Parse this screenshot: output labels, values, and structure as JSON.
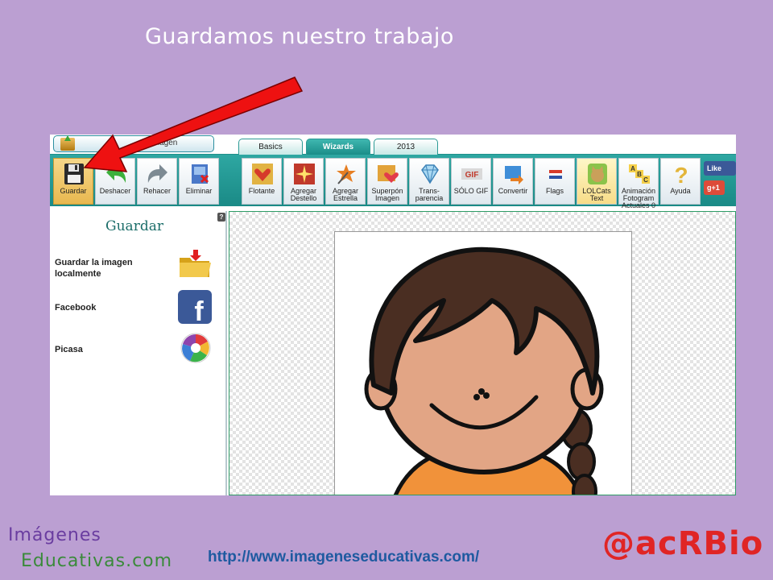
{
  "slide": {
    "title": "Guardamos nuestro trabajo"
  },
  "app": {
    "open_button_label": "Imagen",
    "tabs": [
      {
        "label": "Basics",
        "active": false
      },
      {
        "label": "Wizards",
        "active": true
      },
      {
        "label": "2013",
        "active": false
      }
    ],
    "toolbar_left": [
      {
        "label": "Guardar",
        "icon": "floppy-disk-icon"
      },
      {
        "label": "Deshacer",
        "icon": "undo-arrow-icon"
      },
      {
        "label": "Rehacer",
        "icon": "redo-arrow-icon"
      },
      {
        "label": "Eliminar",
        "icon": "delete-image-icon"
      }
    ],
    "toolbar_right": [
      {
        "label": "Flotante",
        "icon": "float-hearts-icon"
      },
      {
        "label": "Agregar Destello",
        "icon": "sparkle-icon"
      },
      {
        "label": "Agregar Estrella",
        "icon": "star-wand-icon"
      },
      {
        "label": "Superpón Imagen",
        "icon": "overlay-image-icon"
      },
      {
        "label": "Trans-parencia",
        "icon": "diamond-icon"
      },
      {
        "label": "SÓLO GIF",
        "icon": "gif-icon"
      },
      {
        "label": "Convertir",
        "icon": "convert-icon"
      },
      {
        "label": "Flags",
        "icon": "flag-icon"
      },
      {
        "label": "LOLCats Text",
        "icon": "cat-icon"
      },
      {
        "label": "Animación Fotogram Actuales 0",
        "icon": "abc-animation-icon"
      },
      {
        "label": "Ayuda",
        "icon": "question-mark-icon"
      }
    ],
    "social": {
      "like": "Like",
      "gplus": "g+1"
    }
  },
  "panel": {
    "title": "Guardar",
    "help": "?",
    "items": [
      {
        "label": "Guardar la imagen localmente",
        "icon": "folder-download-icon"
      },
      {
        "label": "Facebook",
        "icon": "facebook-icon"
      },
      {
        "label": "Picasa",
        "icon": "picasa-icon"
      }
    ]
  },
  "footer": {
    "logo_line1": "Imágenes",
    "logo_line2": "Educativas.com",
    "url": "http://www.imageneseducativas.com/",
    "handle": "@acRBio"
  },
  "colors": {
    "background": "#bb9fd2",
    "toolbar": "#1f9a95",
    "arrow": "#ee1111",
    "url": "#1e5aa0",
    "handle": "#e02525"
  }
}
